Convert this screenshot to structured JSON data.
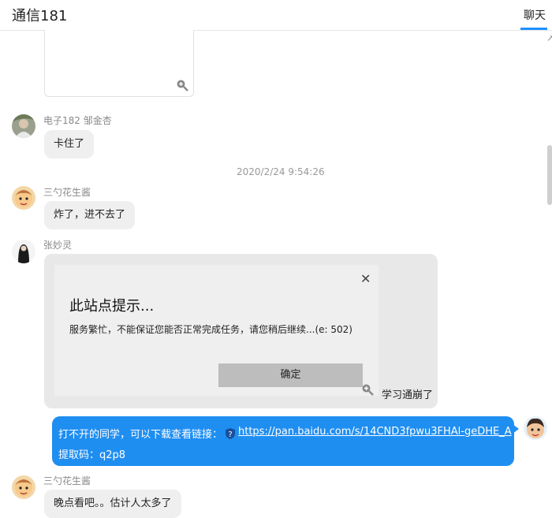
{
  "header": {
    "title": "通信181",
    "tab_label": "聊天"
  },
  "messages": {
    "m1": {
      "sender": "电子182 邹金杏",
      "text": "卡住了"
    },
    "timestamp": "2020/2/24 9:54:26",
    "m2": {
      "sender": "三勺花生酱",
      "text": "炸了，进不去了"
    },
    "m3": {
      "sender": "张妙灵",
      "dialog_title": "此站点提示...",
      "dialog_message": "服务繁忙，不能保证您能否正常完成任务，请您稍后继续...(e: 502)",
      "dialog_button": "确定",
      "caption": "学习通崩了"
    },
    "m4": {
      "line1_prefix": "打不开的同学，可以下载查看链接：",
      "link": "https://pan.baidu.com/s/14CND3fpwu3FHAl-geDHE_A",
      "line2": "提取码：q2p8"
    },
    "m5": {
      "sender": "三勺花生酱",
      "text": "晚点看吧。。估计人太多了"
    }
  },
  "colors": {
    "accent": "#1e90ff",
    "own_bubble": "#1f8ef1",
    "other_bubble": "#efefef"
  },
  "icons": [
    "zoom-in-icon",
    "close-icon",
    "question-icon"
  ]
}
